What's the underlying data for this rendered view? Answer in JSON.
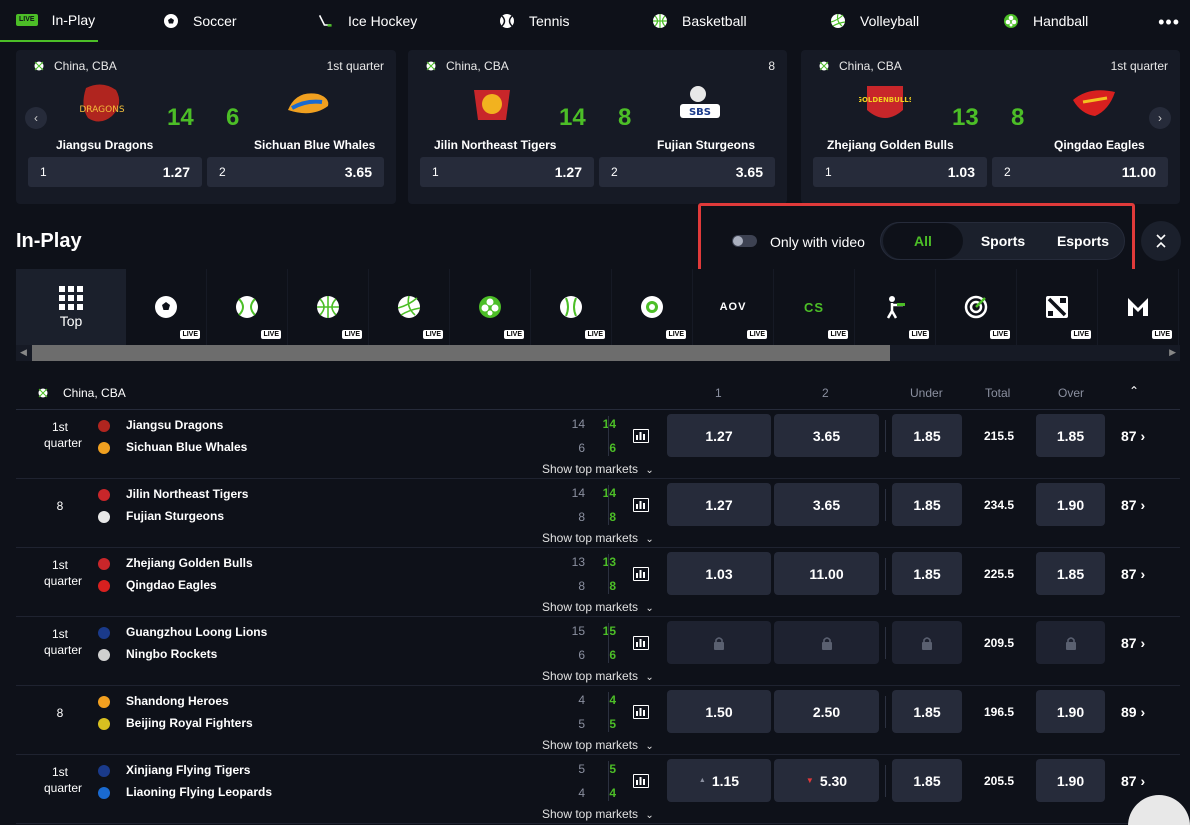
{
  "nav": {
    "live_label": "LIVE",
    "items": [
      {
        "label": "In-Play",
        "icon": "live-tv-icon"
      },
      {
        "label": "Soccer",
        "icon": "soccer-ball-icon"
      },
      {
        "label": "Ice Hockey",
        "icon": "hockey-stick-icon"
      },
      {
        "label": "Tennis",
        "icon": "tennis-ball-icon"
      },
      {
        "label": "Basketball",
        "icon": "basketball-icon"
      },
      {
        "label": "Volleyball",
        "icon": "volleyball-icon"
      },
      {
        "label": "Handball",
        "icon": "handball-icon"
      }
    ],
    "more": "•••"
  },
  "cards": [
    {
      "league": "China, CBA",
      "period": "1st quarter",
      "home": "Jiangsu Dragons",
      "away": "Sichuan Blue Whales",
      "home_score": "14",
      "away_score": "6",
      "odd1_label": "1",
      "odd1": "1.27",
      "odd2_label": "2",
      "odd2": "3.65"
    },
    {
      "league": "China, CBA",
      "period": "8",
      "home": "Jilin Northeast Tigers",
      "away": "Fujian Sturgeons",
      "home_score": "14",
      "away_score": "8",
      "odd1_label": "1",
      "odd1": "1.27",
      "odd2_label": "2",
      "odd2": "3.65"
    },
    {
      "league": "China, CBA",
      "period": "1st quarter",
      "home": "Zhejiang Golden Bulls",
      "away": "Qingdao Eagles",
      "home_score": "13",
      "away_score": "8",
      "odd1_label": "1",
      "odd1": "1.03",
      "odd2_label": "2",
      "odd2": "11.00"
    }
  ],
  "inplay": {
    "title": "In-Play",
    "video_toggle_label": "Only with video",
    "segments": [
      "All",
      "Sports",
      "Esports"
    ],
    "active_segment": "All"
  },
  "strip": {
    "top_label": "Top",
    "live_label": "LIVE",
    "sports": [
      "soccer-icon",
      "tennis-icon",
      "basketball-icon",
      "volleyball-icon",
      "handball-icon",
      "baseball-icon",
      "ice-hockey-icon",
      "aov-icon",
      "cs-icon",
      "shooter-icon",
      "target-icon",
      "dota-icon",
      "mobile-legends-icon"
    ],
    "aov_text": "AOV",
    "cs_text": "CS"
  },
  "table": {
    "league": "China, CBA",
    "headers": {
      "h1": "1",
      "h2": "2",
      "under": "Under",
      "total": "Total",
      "over": "Over"
    },
    "show_top_markets": "Show top markets",
    "rows": [
      {
        "period_a": "1st",
        "period_b": "quarter",
        "home": "Jiangsu Dragons",
        "away": "Sichuan Blue Whales",
        "hs_prev": "14",
        "hs": "14",
        "as_prev": "6",
        "as": "6",
        "o1": "1.27",
        "o2": "3.65",
        "under": "1.85",
        "total": "215.5",
        "over": "1.85",
        "markets": "87"
      },
      {
        "period_a": "8",
        "period_b": "",
        "home": "Jilin Northeast Tigers",
        "away": "Fujian Sturgeons",
        "hs_prev": "14",
        "hs": "14",
        "as_prev": "8",
        "as": "8",
        "o1": "1.27",
        "o2": "3.65",
        "under": "1.85",
        "total": "234.5",
        "over": "1.90",
        "markets": "87"
      },
      {
        "period_a": "1st",
        "period_b": "quarter",
        "home": "Zhejiang Golden Bulls",
        "away": "Qingdao Eagles",
        "hs_prev": "13",
        "hs": "13",
        "as_prev": "8",
        "as": "8",
        "o1": "1.03",
        "o2": "11.00",
        "under": "1.85",
        "total": "225.5",
        "over": "1.85",
        "markets": "87"
      },
      {
        "period_a": "1st",
        "period_b": "quarter",
        "home": "Guangzhou Loong Lions",
        "away": "Ningbo Rockets",
        "hs_prev": "15",
        "hs": "15",
        "as_prev": "6",
        "as": "6",
        "o1": "",
        "o2": "",
        "under": "",
        "total": "209.5",
        "over": "",
        "markets": "87",
        "locked": true
      },
      {
        "period_a": "8",
        "period_b": "",
        "home": "Shandong Heroes",
        "away": "Beijing Royal Fighters",
        "hs_prev": "4",
        "hs": "4",
        "as_prev": "5",
        "as": "5",
        "o1": "1.50",
        "o2": "2.50",
        "under": "1.85",
        "total": "196.5",
        "over": "1.90",
        "markets": "89"
      },
      {
        "period_a": "1st",
        "period_b": "quarter",
        "home": "Xinjiang Flying Tigers",
        "away": "Liaoning Flying Leopards",
        "hs_prev": "5",
        "hs": "5",
        "as_prev": "4",
        "as": "4",
        "o1": "1.15",
        "o2": "5.30",
        "under": "1.85",
        "total": "205.5",
        "over": "1.90",
        "markets": "87"
      }
    ]
  },
  "colors": {
    "accent": "#4cbe27",
    "bg": "#0e1119",
    "card": "#161a25",
    "button": "#262b3a",
    "highlight": "#e03a3a"
  }
}
